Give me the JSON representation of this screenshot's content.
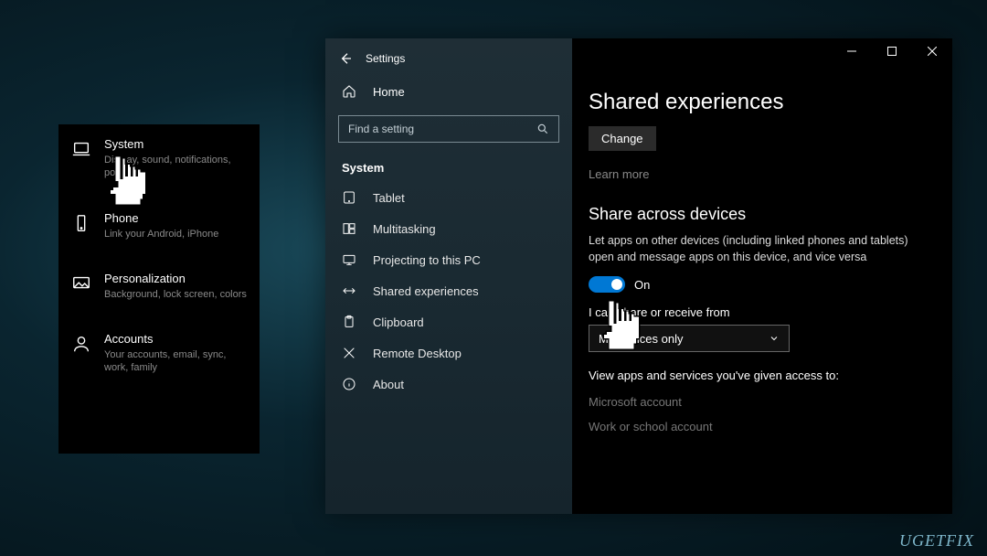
{
  "mini_panel": {
    "items": [
      {
        "title": "System",
        "sub": "Display, sound, notifications, power"
      },
      {
        "title": "Phone",
        "sub": "Link your Android, iPhone"
      },
      {
        "title": "Personalization",
        "sub": "Background, lock screen, colors"
      },
      {
        "title": "Accounts",
        "sub": "Your accounts, email, sync, work, family"
      }
    ]
  },
  "window": {
    "title": "Settings",
    "home": "Home",
    "search_placeholder": "Find a setting",
    "category": "System",
    "nav": [
      "Tablet",
      "Multitasking",
      "Projecting to this PC",
      "Shared experiences",
      "Clipboard",
      "Remote Desktop",
      "About"
    ]
  },
  "content": {
    "page_title": "Shared experiences",
    "change_btn": "Change",
    "learn_more": "Learn more",
    "share_title": "Share across devices",
    "share_desc": "Let apps on other devices (including linked phones and tablets) open and message apps on this device, and vice versa",
    "toggle_label": "On",
    "receive_label": "I can share or receive from",
    "dropdown_value": "My devices only",
    "view_apps": "View apps and services you've given access to:",
    "ms_account": "Microsoft account",
    "work_account": "Work or school account"
  },
  "watermark": "UGETFIX"
}
